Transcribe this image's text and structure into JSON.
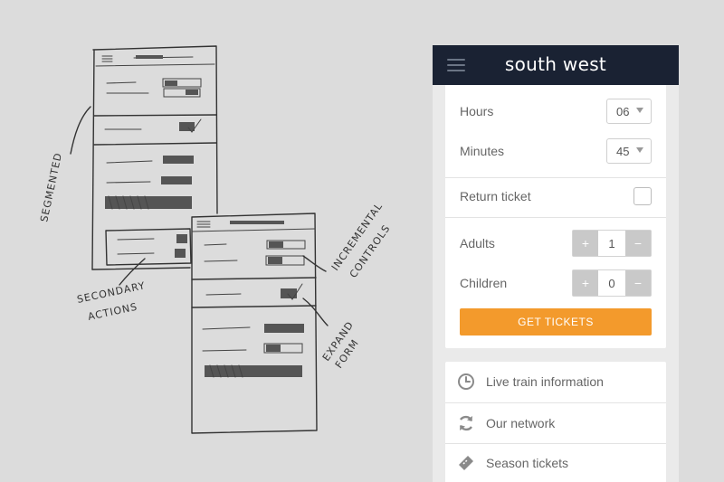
{
  "brand": "south west",
  "form": {
    "hours": {
      "label": "Hours",
      "value": "06"
    },
    "minutes": {
      "label": "Minutes",
      "value": "45"
    },
    "return_ticket": {
      "label": "Return ticket",
      "checked": false
    },
    "adults": {
      "label": "Adults",
      "value": "1"
    },
    "children": {
      "label": "Children",
      "value": "0"
    },
    "plus_symbol": "+",
    "minus_symbol": "−",
    "cta_label": "GET TICKETS"
  },
  "links": [
    {
      "label": "Live train information",
      "icon": "clock-icon"
    },
    {
      "label": "Our network",
      "icon": "refresh-icon"
    },
    {
      "label": "Season tickets",
      "icon": "ticket-icon"
    }
  ],
  "sketch_annotations": {
    "left": "SEGMENTED",
    "secondary": [
      "SECONDARY",
      "ACTIONS"
    ],
    "incremental": [
      "INCREMENTAL",
      "CONTROLS"
    ],
    "expand": [
      "EXPAND",
      "FORM"
    ]
  },
  "colors": {
    "header": "#1a2233",
    "cta": "#f39a2c",
    "background": "#dcdcdc"
  }
}
